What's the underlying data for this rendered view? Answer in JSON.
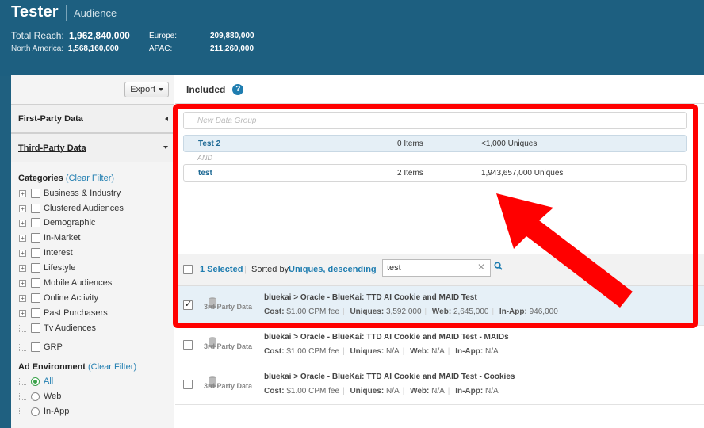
{
  "header": {
    "title": "Tester",
    "subtitle": "Audience",
    "total_reach_label": "Total Reach:",
    "total_reach_value": "1,962,840,000",
    "na_label": "North America:",
    "na_value": "1,568,160,000",
    "europe_label": "Europe:",
    "europe_value": "209,880,000",
    "apac_label": "APAC:",
    "apac_value": "211,260,000"
  },
  "sidebar": {
    "export_label": "Export",
    "first_party": "First-Party Data",
    "third_party": "Third-Party Data",
    "categories_label": "Categories",
    "clear_filter": "(Clear Filter)",
    "categories": [
      "Business & Industry",
      "Clustered Audiences",
      "Demographic",
      "In-Market",
      "Interest",
      "Lifestyle",
      "Mobile Audiences",
      "Online Activity",
      "Past Purchasers",
      "Tv Audiences",
      "GRP"
    ],
    "ad_env_label": "Ad Environment",
    "ad_env_options": [
      "All",
      "Web",
      "In-App"
    ]
  },
  "content": {
    "included_label": "Included",
    "new_group_placeholder": "New Data Group",
    "groups": [
      {
        "name": "Test 2",
        "items": "0 Items",
        "uniques": "<1,000 Uniques"
      },
      {
        "name": "test",
        "items": "2 Items",
        "uniques": "1,943,657,000 Uniques"
      }
    ],
    "and_label": "AND",
    "toolbar": {
      "selected_count": "1 Selected",
      "sorted_by_label": "Sorted by",
      "sorted_by_value": "Uniques, descending",
      "search_value": "test"
    },
    "rows": [
      {
        "title": "bluekai > Oracle - BlueKai: TTD AI Cookie and MAID Test",
        "cost_label": "Cost:",
        "cost": "$1.00 CPM fee",
        "uniques_label": "Uniques:",
        "uniques": "3,592,000",
        "web_label": "Web:",
        "web": "2,645,000",
        "inapp_label": "In-App:",
        "inapp": "946,000",
        "checked": true
      },
      {
        "title": "bluekai > Oracle - BlueKai: TTD AI Cookie and MAID Test - MAIDs",
        "cost_label": "Cost:",
        "cost": "$1.00 CPM fee",
        "uniques_label": "Uniques:",
        "uniques": "N/A",
        "web_label": "Web:",
        "web": "N/A",
        "inapp_label": "In-App:",
        "inapp": "N/A",
        "checked": false
      },
      {
        "title": "bluekai > Oracle - BlueKai: TTD AI Cookie and MAID Test - Cookies",
        "cost_label": "Cost:",
        "cost": "$1.00 CPM fee",
        "uniques_label": "Uniques:",
        "uniques": "N/A",
        "web_label": "Web:",
        "web": "N/A",
        "inapp_label": "In-App:",
        "inapp": "N/A",
        "checked": false
      }
    ],
    "third_party_logo_text": "3rd Party Data"
  },
  "colors": {
    "header_bg": "#1d5f80",
    "link": "#1f7db0",
    "annotation": "#ff0000"
  }
}
